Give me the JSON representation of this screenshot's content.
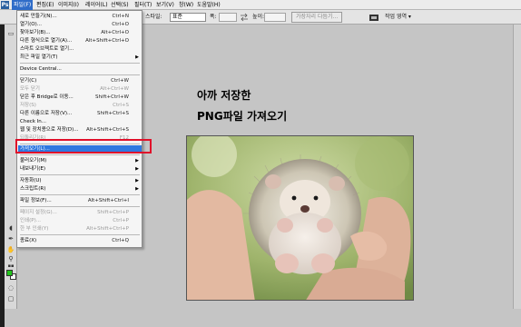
{
  "menubar": {
    "logo": "Ps",
    "items": [
      "파일(F)",
      "편집(E)",
      "이미지(I)",
      "레이어(L)",
      "선택(S)",
      "필터(T)",
      "보기(V)",
      "창(W)",
      "도움말(H)"
    ]
  },
  "options": {
    "style_label": "스타일:",
    "style_value": "표준",
    "width_label": "폭:",
    "height_label": "높이:",
    "refine_button": "가장자리 다듬기...",
    "workspace_label": "작업 영역 ▾"
  },
  "file_menu": {
    "items": [
      {
        "label": "새로 만들기(N)...",
        "shortcut": "Ctrl+N"
      },
      {
        "label": "열기(O)...",
        "shortcut": "Ctrl+O"
      },
      {
        "label": "찾아보기(B)...",
        "shortcut": "Alt+Ctrl+O"
      },
      {
        "label": "다른 형식으로 열기(A)...",
        "shortcut": "Alt+Shift+Ctrl+O"
      },
      {
        "label": "스마트 오브젝트로 열기...",
        "shortcut": ""
      },
      {
        "label": "최근 파일 열기(T)",
        "shortcut": "",
        "submenu": true
      },
      {
        "label": "Device Central...",
        "shortcut": ""
      },
      {
        "label": "닫기(C)",
        "shortcut": "Ctrl+W"
      },
      {
        "label": "모두 닫기",
        "shortcut": "Alt+Ctrl+W",
        "disabled": true
      },
      {
        "label": "닫은 후 Bridge로 이동...",
        "shortcut": "Shift+Ctrl+W"
      },
      {
        "label": "저장(S)",
        "shortcut": "Ctrl+S",
        "disabled": true
      },
      {
        "label": "다른 이름으로 저장(V)...",
        "shortcut": "Shift+Ctrl+S"
      },
      {
        "label": "Check In...",
        "shortcut": ""
      },
      {
        "label": "웹 및 장치용으로 저장(D)...",
        "shortcut": "Alt+Shift+Ctrl+S"
      },
      {
        "label": "되돌리기(R)",
        "shortcut": "F12",
        "disabled": true
      },
      {
        "label": "가져오기(L)...",
        "shortcut": "",
        "selected": true
      },
      {
        "label": "불러오기(M)",
        "shortcut": "",
        "submenu": true
      },
      {
        "label": "내보내기(E)",
        "shortcut": "",
        "submenu": true
      },
      {
        "label": "자동화(U)",
        "shortcut": "",
        "submenu": true
      },
      {
        "label": "스크립트(R)",
        "shortcut": "",
        "submenu": true
      },
      {
        "label": "파일 정보(F)...",
        "shortcut": "Alt+Shift+Ctrl+I"
      },
      {
        "label": "페이지 설정(G)...",
        "shortcut": "Shift+Ctrl+P",
        "disabled": true
      },
      {
        "label": "인쇄(P)...",
        "shortcut": "Ctrl+P",
        "disabled": true
      },
      {
        "label": "한 부 인쇄(Y)",
        "shortcut": "Alt+Shift+Ctrl+P",
        "disabled": true
      },
      {
        "label": "종료(X)",
        "shortcut": "Ctrl+Q"
      }
    ]
  },
  "annotation": {
    "line1": "아까 저장한",
    "line2": "PNG파일 가져오기"
  },
  "colors": {
    "highlight": "#e0102a",
    "menu_selection": "#2f78e0",
    "foreground_swatch": "#22c41c"
  }
}
